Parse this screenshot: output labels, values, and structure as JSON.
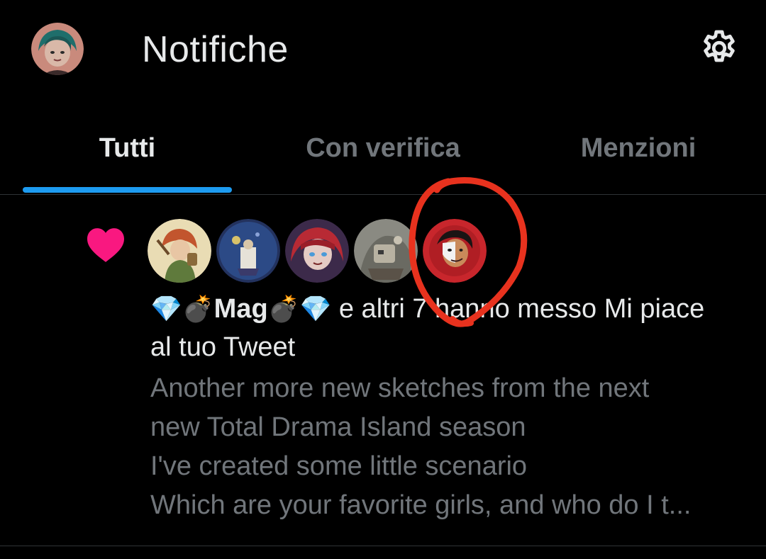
{
  "header": {
    "title": "Notifiche",
    "avatar_icon": "user-avatar-icon",
    "settings_icon": "gear-icon"
  },
  "tabs": [
    {
      "label": "Tutti",
      "active": true
    },
    {
      "label": "Con verifica",
      "active": false
    },
    {
      "label": "Menzioni",
      "active": false
    }
  ],
  "notification": {
    "type_icon": "heart-icon",
    "avatars_count": 5,
    "gem_left": "💎",
    "bomb_left": "💣",
    "actor_name": "Mag",
    "bomb_right": "💣",
    "gem_right": "💎",
    "action_text": " e altri 7 hanno messo Mi piace al tuo Tweet",
    "tweet_lines": [
      "Another more new sketches from the next",
      "new Total Drama Island season",
      "I've created some little scenario",
      "Which are your favorite girls, and who do I t..."
    ]
  },
  "colors": {
    "background": "#000000",
    "accent": "#1d9bf0",
    "heart": "#f91880",
    "text_primary": "#e7e9ea",
    "text_secondary": "#71767b",
    "annotation": "#e8321e"
  }
}
